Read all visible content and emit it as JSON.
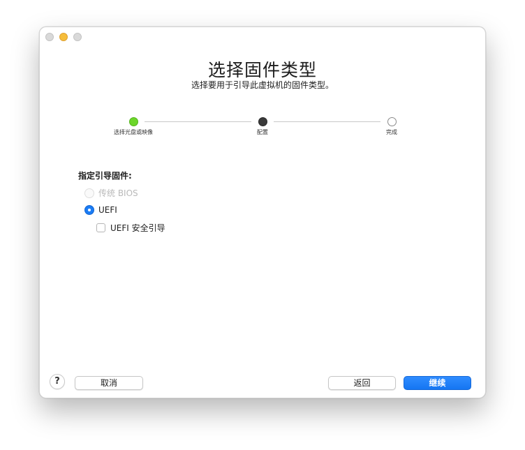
{
  "window": {
    "title": "选择固件类型",
    "subtitle": "选择要用于引导此虚拟机的固件类型。"
  },
  "steps": [
    {
      "label": "选择光盘或映像",
      "state": "done"
    },
    {
      "label": "配置",
      "state": "current"
    },
    {
      "label": "完成",
      "state": "pending"
    }
  ],
  "firmware": {
    "section_label": "指定引导固件:",
    "options": [
      {
        "label": "传统 BIOS",
        "selected": false,
        "enabled": false
      },
      {
        "label": "UEFI",
        "selected": true,
        "enabled": true
      }
    ],
    "secure_boot_label": "UEFI 安全引导",
    "secure_boot_checked": false
  },
  "footer": {
    "help_label": "?",
    "cancel_label": "取消",
    "back_label": "返回",
    "continue_label": "继续"
  },
  "colors": {
    "accent": "#1b7cf5",
    "step_done": "#6cd62a",
    "step_current": "#3a3a3a"
  }
}
